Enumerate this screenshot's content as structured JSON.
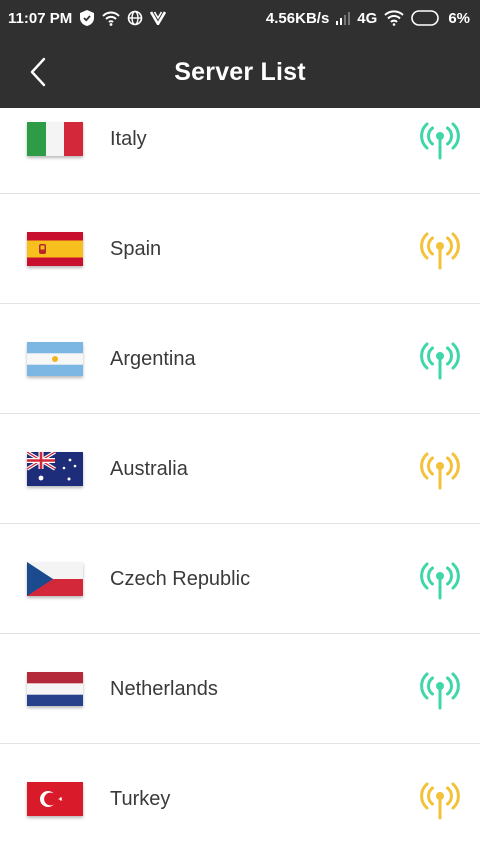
{
  "status_bar": {
    "time": "11:07 PM",
    "network_speed": "4.56KB/s",
    "network_type": "4G",
    "battery": "6%"
  },
  "header": {
    "title": "Server List",
    "back_icon": "chevron-left-icon"
  },
  "colors": {
    "header_bg": "#303030",
    "signal_good": "#3fd6a8",
    "signal_medium": "#f2c23a",
    "divider": "#e3e3e3"
  },
  "servers": [
    {
      "name": "Italy",
      "flag": "italy",
      "signal": "good"
    },
    {
      "name": "Spain",
      "flag": "spain",
      "signal": "medium"
    },
    {
      "name": "Argentina",
      "flag": "argentina",
      "signal": "good"
    },
    {
      "name": "Australia",
      "flag": "australia",
      "signal": "medium"
    },
    {
      "name": "Czech Republic",
      "flag": "czech",
      "signal": "good"
    },
    {
      "name": "Netherlands",
      "flag": "netherlands",
      "signal": "good"
    },
    {
      "name": "Turkey",
      "flag": "turkey",
      "signal": "medium"
    }
  ]
}
